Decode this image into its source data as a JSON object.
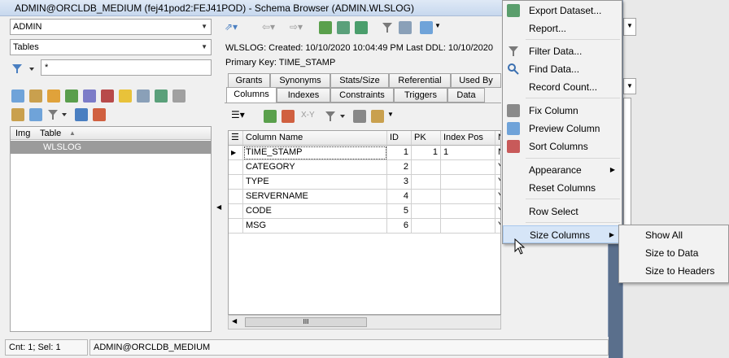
{
  "window": {
    "title": "ADMIN@ORCLDB_MEDIUM (fej41pod2:FEJ41POD) - Schema Browser (ADMIN.WLSLOG)"
  },
  "left": {
    "schema_value": "ADMIN",
    "object_type_value": "Tables",
    "filter_value": "*",
    "tree_headers": [
      "Img",
      "Table"
    ],
    "tree_rows": [
      "WLSLOG"
    ]
  },
  "info": {
    "object_line": "WLSLOG:  Created: 10/10/2020 10:04:49 PM   Last DDL: 10/10/2020",
    "primary_key_line": "Primary Key:  TIME_STAMP"
  },
  "tabs_row1": [
    "Grants",
    "Synonyms",
    "Stats/Size",
    "Referential",
    "Used By"
  ],
  "tabs_row2": [
    "Columns",
    "Indexes",
    "Constraints",
    "Triggers",
    "Data"
  ],
  "toolbar": {
    "xy_label": "X-Y"
  },
  "grid": {
    "headers": [
      "Column Name",
      "ID",
      "PK",
      "Index Pos",
      "N"
    ],
    "rows": [
      {
        "name": "TIME_STAMP",
        "id": "1",
        "pk": "1",
        "index_pos": "1",
        "n": "N"
      },
      {
        "name": "CATEGORY",
        "id": "2",
        "pk": "",
        "index_pos": "",
        "n": "Y"
      },
      {
        "name": "TYPE",
        "id": "3",
        "pk": "",
        "index_pos": "",
        "n": "Y"
      },
      {
        "name": "SERVERNAME",
        "id": "4",
        "pk": "",
        "index_pos": "",
        "n": "Y"
      },
      {
        "name": "CODE",
        "id": "5",
        "pk": "",
        "index_pos": "",
        "n": "Y"
      },
      {
        "name": "MSG",
        "id": "6",
        "pk": "",
        "index_pos": "",
        "n": "Y"
      }
    ],
    "scroll_thumb_label": "III"
  },
  "context_menu": {
    "items": [
      {
        "label": "Export Dataset...",
        "icon": "export-icon"
      },
      {
        "label": "Report...",
        "icon": ""
      },
      {
        "label": "Filter Data...",
        "icon": "filter-icon"
      },
      {
        "label": "Find Data...",
        "icon": "find-icon"
      },
      {
        "label": "Record Count...",
        "icon": ""
      },
      {
        "label": "Fix Column",
        "icon": "fix-column-icon"
      },
      {
        "label": "Preview Column",
        "icon": "preview-column-icon"
      },
      {
        "label": "Sort Columns",
        "icon": "sort-columns-icon"
      },
      {
        "label": "Appearance",
        "icon": ""
      },
      {
        "label": "Reset Columns",
        "icon": ""
      },
      {
        "label": "Row Select",
        "icon": ""
      },
      {
        "label": "Size Columns",
        "icon": ""
      }
    ]
  },
  "submenu": {
    "items": [
      "Show All",
      "Size to Data",
      "Size to Headers"
    ]
  },
  "status": {
    "counts": "Cnt: 1; Sel: 1",
    "connection": "ADMIN@ORCLDB_MEDIUM"
  },
  "colors": {
    "selection_gray": "#9b9b9b",
    "menu_highlight": "#d6e5f7",
    "desktop": "#5a6f8c"
  }
}
